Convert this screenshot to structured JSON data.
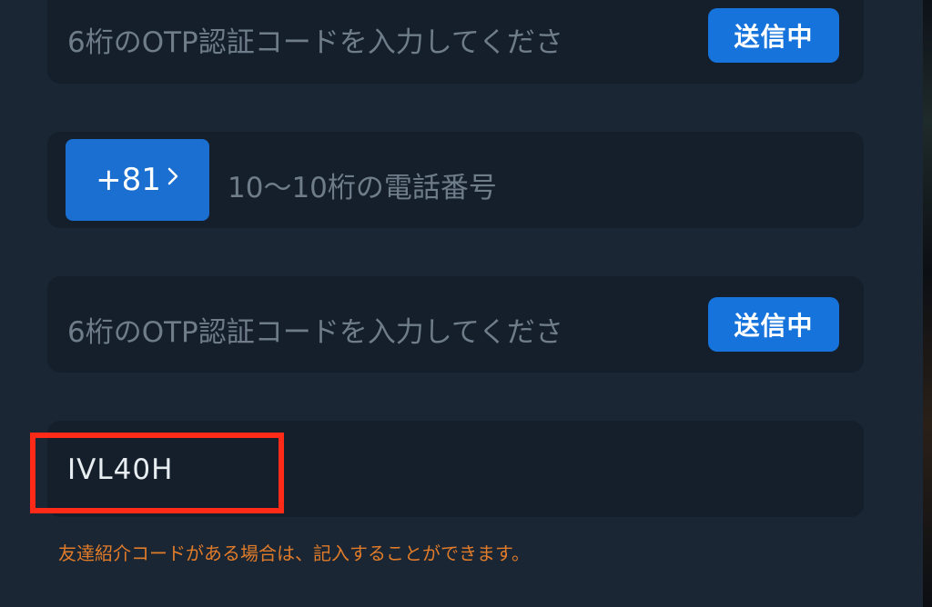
{
  "otp_field_top": {
    "placeholder": "6桁のOTP認証コードを入力してくださ",
    "send_label": "送信中"
  },
  "phone_field": {
    "country_code": "+81",
    "placeholder": "10〜10桁の電話番号"
  },
  "otp_field_bottom": {
    "placeholder": "6桁のOTP認証コードを入力してくださ",
    "send_label": "送信中"
  },
  "referral_field": {
    "value": "IVL40H",
    "hint": "友達紹介コードがある場合は、記入することができます。"
  },
  "colors": {
    "background": "#1a2634",
    "field": "#141f2b",
    "button_blue": "#1673dc",
    "highlight": "#ff2a17",
    "hint": "#e07b29"
  },
  "icons": {
    "country_chevron": "chevron-right-icon"
  }
}
